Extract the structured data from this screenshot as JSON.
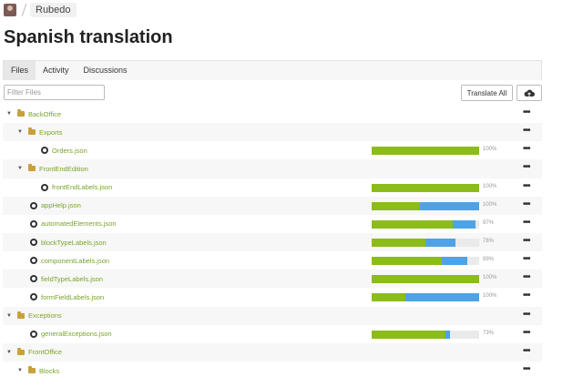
{
  "breadcrumb": {
    "project": "Rubedo"
  },
  "page": {
    "title": "Spanish translation"
  },
  "tabs": [
    {
      "label": "Files",
      "active": true
    },
    {
      "label": "Activity",
      "active": false
    },
    {
      "label": "Discussions",
      "active": false
    }
  ],
  "toolbar": {
    "filter_placeholder": "Filter Files",
    "translate_all_label": "Translate All",
    "cloud_icon": "cloud-icon"
  },
  "colors": {
    "translated": "#8cbc1a",
    "approved": "#4da3e6",
    "link": "#7aa32a"
  },
  "files": [
    {
      "type": "folder",
      "name": "BackOffice",
      "level": 0,
      "expanded": true
    },
    {
      "type": "folder",
      "name": "Exports",
      "level": 1,
      "expanded": true
    },
    {
      "type": "file",
      "name": "Orders.json",
      "level": 2,
      "translated": 100,
      "approved": 0,
      "percent": "100%"
    },
    {
      "type": "folder",
      "name": "FrontEndEdition",
      "level": 1,
      "expanded": true
    },
    {
      "type": "file",
      "name": "frontEndLabels.json",
      "level": 2,
      "translated": 100,
      "approved": 0,
      "percent": "100%"
    },
    {
      "type": "file",
      "name": "appHelp.json",
      "level": 1,
      "translated": 45,
      "approved": 55,
      "percent": "100%"
    },
    {
      "type": "file",
      "name": "automatedElements.json",
      "level": 1,
      "translated": 75,
      "approved": 22,
      "percent": "97%"
    },
    {
      "type": "file",
      "name": "blockTypeLabels.json",
      "level": 1,
      "translated": 50,
      "approved": 28,
      "percent": "78%"
    },
    {
      "type": "file",
      "name": "componentLabels.json",
      "level": 1,
      "translated": 65,
      "approved": 24,
      "percent": "89%"
    },
    {
      "type": "file",
      "name": "fieldTypeLabels.json",
      "level": 1,
      "translated": 100,
      "approved": 0,
      "percent": "100%"
    },
    {
      "type": "file",
      "name": "formFieldLabels.json",
      "level": 1,
      "translated": 31,
      "approved": 69,
      "percent": "100%"
    },
    {
      "type": "folder",
      "name": "Exceptions",
      "level": 0,
      "expanded": true
    },
    {
      "type": "file",
      "name": "generalExceptions.json",
      "level": 1,
      "translated": 69,
      "approved": 4,
      "percent": "73%"
    },
    {
      "type": "folder",
      "name": "FrontOffice",
      "level": 0,
      "expanded": true
    },
    {
      "type": "folder",
      "name": "Blocks",
      "level": 1,
      "expanded": true
    }
  ]
}
